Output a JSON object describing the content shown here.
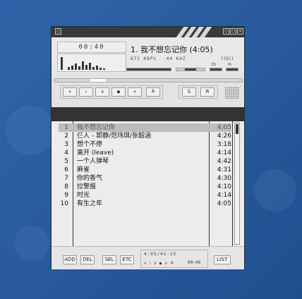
{
  "player": {
    "elapsed_time": "00:40",
    "now_playing": "1. 我不想忘记你 (4:05)",
    "bitrate": "872",
    "bitrate_unit": "KBPS",
    "samplerate": "44",
    "samplerate_unit": "KHZ",
    "stereo": "((S))",
    "eq_label": "EQ",
    "pl_label": "PL"
  },
  "controls": {
    "prev": "«",
    "play": "›",
    "pause": "॥",
    "stop": "▪",
    "next": "»",
    "eject": "≙",
    "shuffle": "S",
    "repeat": "R"
  },
  "playlist": {
    "tracks": [
      {
        "num": "1",
        "title": "我不想忘记你",
        "duration": "4:05",
        "selected": true
      },
      {
        "num": "2",
        "title": "仨人 - 郭静/范玮琪/张韶涵",
        "duration": "4:26"
      },
      {
        "num": "3",
        "title": "想个不停",
        "duration": "3:18"
      },
      {
        "num": "4",
        "title": "离开 (leave)",
        "duration": "4:14"
      },
      {
        "num": "5",
        "title": "一个人弹琴",
        "duration": "4:42"
      },
      {
        "num": "6",
        "title": "麻雀",
        "duration": "4:31"
      },
      {
        "num": "7",
        "title": "你的香气",
        "duration": "4:30"
      },
      {
        "num": "8",
        "title": "拉警报",
        "duration": "4:10"
      },
      {
        "num": "9",
        "title": "时光",
        "duration": "4:14"
      },
      {
        "num": "10",
        "title": "有生之年",
        "duration": "4:05"
      }
    ]
  },
  "bottom": {
    "add": "ADD",
    "del": "DEL",
    "sel": "SEL",
    "etc": "ETC",
    "list": "LIST",
    "total_time": "4:05/42:15",
    "mini_controls": "« › ॥ ▪ » ≙",
    "mini_elapsed": "00:40"
  },
  "colors": {
    "desktop": "#2a5c9f",
    "window_bg": "#e3e3e3",
    "dark_bar": "#333333",
    "selected_row": "#bdbdbd"
  }
}
